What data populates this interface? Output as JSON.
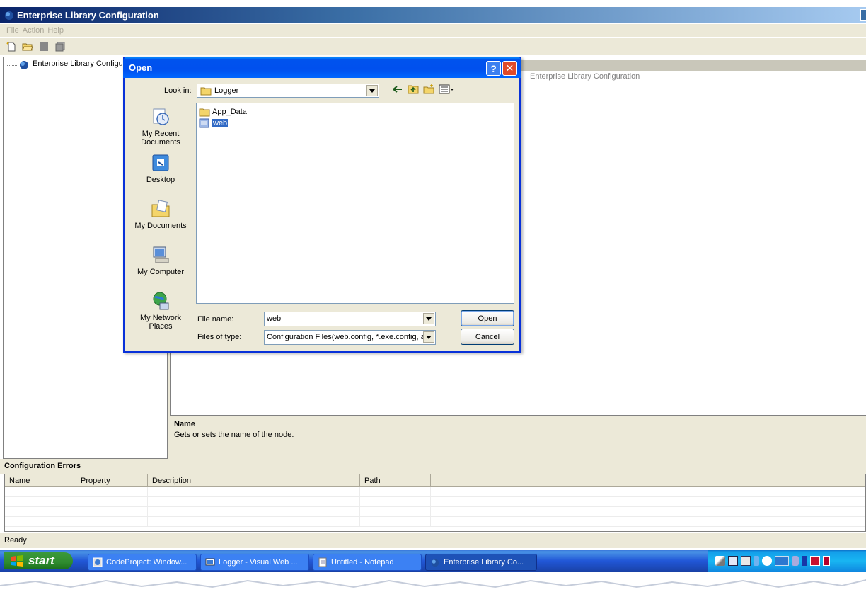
{
  "app": {
    "title": "Enterprise Library Configuration",
    "menu": [
      "File",
      "Action",
      "Help"
    ],
    "toolbar_icons": [
      "new-icon",
      "open-folder-icon",
      "save-icon",
      "save-all-icon"
    ],
    "tree_root": "Enterprise Library Configura",
    "right_header": "Enterprise Library Configuration",
    "property_help": {
      "name": "Name",
      "description": "Gets or sets the name of the node."
    },
    "errors": {
      "title": "Configuration Errors",
      "columns": [
        "Name",
        "Property",
        "Description",
        "Path"
      ]
    },
    "status": "Ready"
  },
  "dialog": {
    "title": "Open",
    "look_in_label": "Look in:",
    "look_in_value": "Logger",
    "places": [
      {
        "label": "My Recent Documents",
        "icon": "recent-documents-icon"
      },
      {
        "label": "Desktop",
        "icon": "desktop-icon"
      },
      {
        "label": "My Documents",
        "icon": "my-documents-icon"
      },
      {
        "label": "My Computer",
        "icon": "my-computer-icon"
      },
      {
        "label": "My Network Places",
        "icon": "network-places-icon"
      }
    ],
    "files": [
      {
        "name": "App_Data",
        "type": "folder"
      },
      {
        "name": "web",
        "type": "config-file",
        "selected": true
      }
    ],
    "file_name_label": "File name:",
    "file_name_value": "web",
    "files_of_type_label": "Files of type:",
    "files_of_type_value": "Configuration Files(web.config, *.exe.config, ap",
    "open_button": "Open",
    "cancel_button": "Cancel",
    "help_button": "?",
    "close_button": "✕"
  },
  "taskbar": {
    "start_label": "start",
    "tasks": [
      {
        "label": "CodeProject: Window..."
      },
      {
        "label": "Logger - Visual Web ..."
      },
      {
        "label": "Untitled - Notepad"
      },
      {
        "label": "Enterprise Library Co...",
        "active": true
      }
    ]
  }
}
